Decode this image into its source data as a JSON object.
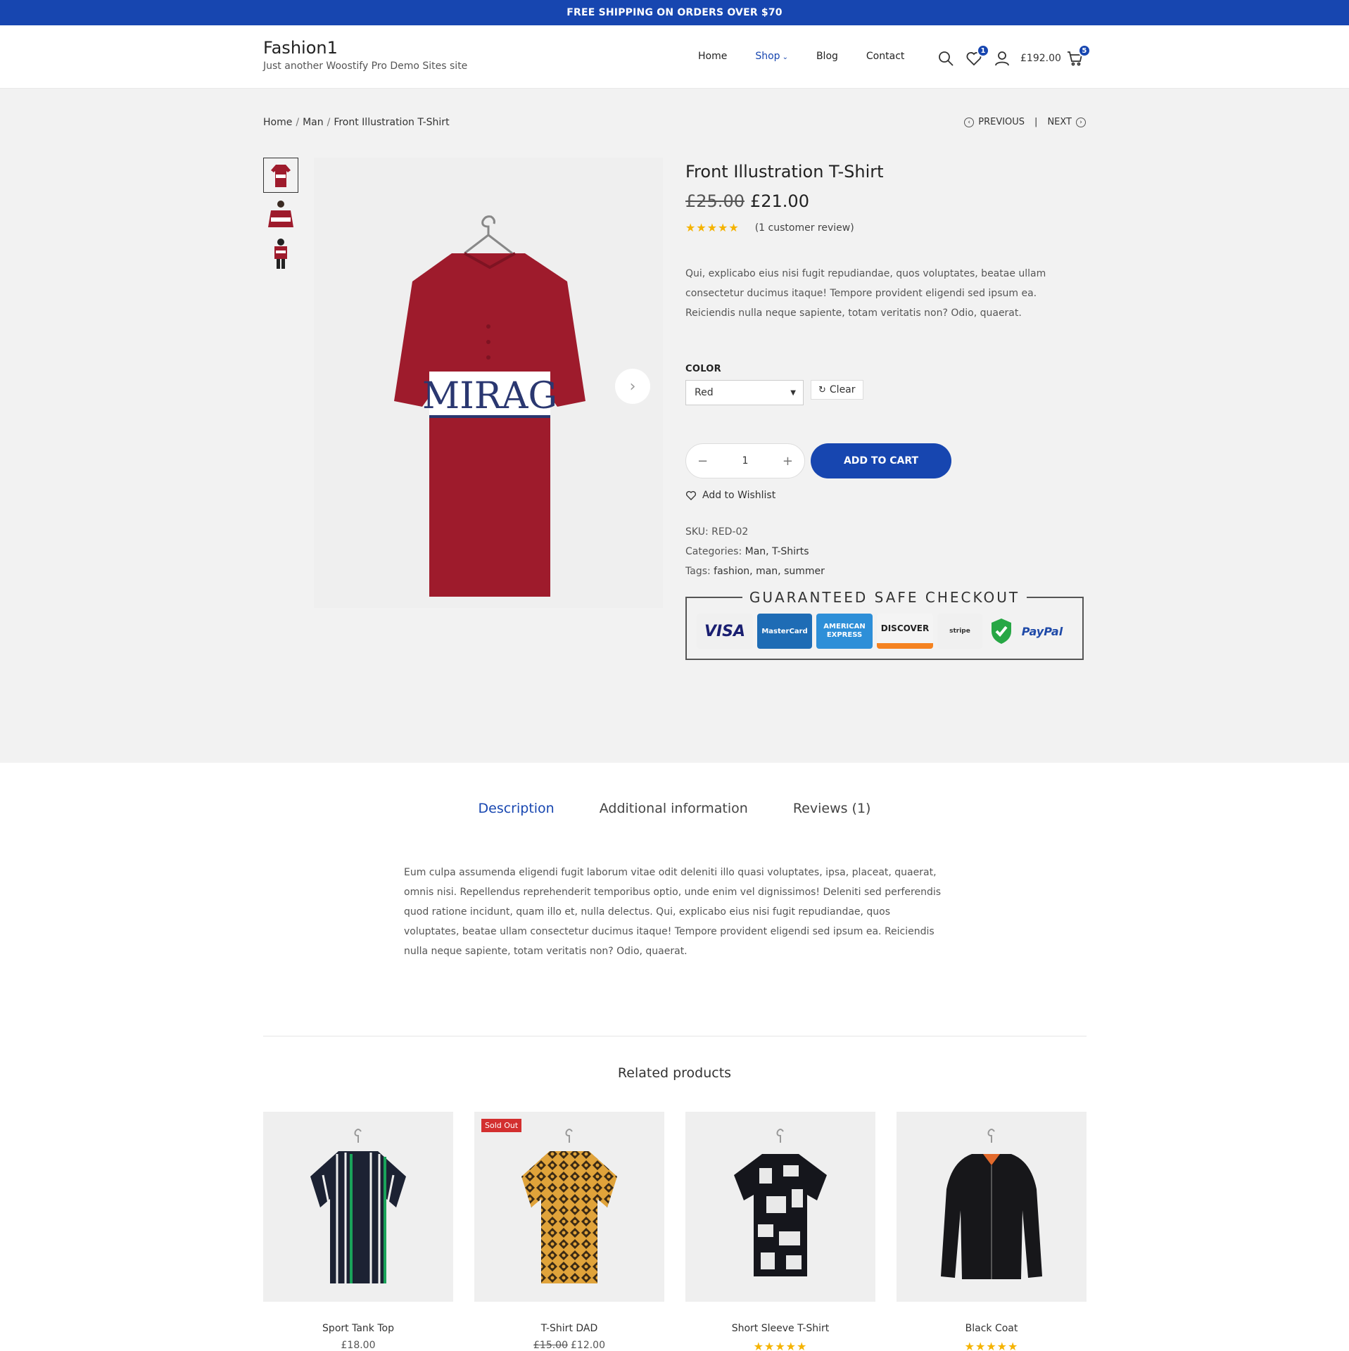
{
  "topbar": {
    "text": "FREE SHIPPING ON ORDERS OVER $70"
  },
  "site": {
    "title": "Fashion1",
    "tagline": "Just another Woostify Pro Demo Sites site"
  },
  "nav": {
    "items": [
      "Home",
      "Shop",
      "Blog",
      "Contact"
    ],
    "active": "Shop"
  },
  "header_icons": {
    "wishlist_count": "1",
    "cart_total": "£192.00",
    "cart_count": "5"
  },
  "breadcrumb": {
    "items": [
      "Home",
      "Man",
      "Front Illustration T-Shirt"
    ]
  },
  "product_nav": {
    "previous": "PREVIOUS",
    "separator": "|",
    "next": "NEXT"
  },
  "product": {
    "title": "Front Illustration T-Shirt",
    "old_price": "£25.00",
    "price": "£21.00",
    "rating": 5,
    "review_text": "(1 customer review)",
    "short_description": "Qui, explicabo eius nisi fugit repudiandae, quos voluptates, beatae ullam consectetur ducimus itaque! Tempore provident eligendi sed ipsum ea. Reiciendis nulla neque sapiente, totam veritatis non? Odio, quaerat.",
    "color_label": "COLOR",
    "color_value": "Red",
    "clear_label": "Clear",
    "quantity": "1",
    "add_to_cart": "ADD TO CART",
    "wishlist": "Add to Wishlist",
    "sku_label": "SKU:",
    "sku": "RED-02",
    "categories_label": "Categories:",
    "categories": "Man, T-Shirts",
    "tags_label": "Tags:",
    "tags": "fashion, man, summer",
    "image_text": "MIRAG"
  },
  "safe_checkout": {
    "title": "GUARANTEED SAFE CHECKOUT",
    "cards": [
      "VISA",
      "MasterCard",
      "AMERICAN EXPRESS",
      "DISCOVER",
      "stripe",
      "PayPal"
    ]
  },
  "tabs": [
    "Description",
    "Additional information",
    "Reviews (1)"
  ],
  "active_tab": "Description",
  "description": "Eum culpa assumenda eligendi fugit laborum vitae odit deleniti illo quasi voluptates, ipsa, placeat, quaerat, omnis nisi. Repellendus reprehenderit temporibus optio, unde enim vel dignissimos! Deleniti sed perferendis quod ratione incidunt, quam illo et, nulla delectus. Qui, explicabo eius nisi fugit repudiandae, quos voluptates, beatae ullam consectetur ducimus itaque! Tempore provident eligendi sed ipsum ea. Reiciendis nulla neque sapiente, totam veritatis non? Odio, quaerat.",
  "related": {
    "title": "Related products",
    "items": [
      {
        "name": "Sport Tank Top",
        "price": "£18.00",
        "badge": ""
      },
      {
        "name": "T-Shirt DAD",
        "old_price": "£15.00",
        "price": "£12.00",
        "badge": "Sold Out"
      },
      {
        "name": "Short Sleeve T-Shirt",
        "rating": 5
      },
      {
        "name": "Black Coat",
        "rating": 5
      }
    ]
  },
  "colors": {
    "accent": "#1746b0",
    "sale_badge": "#d32f2f",
    "star": "#f5b301",
    "page_bg": "#f2f2f2"
  }
}
